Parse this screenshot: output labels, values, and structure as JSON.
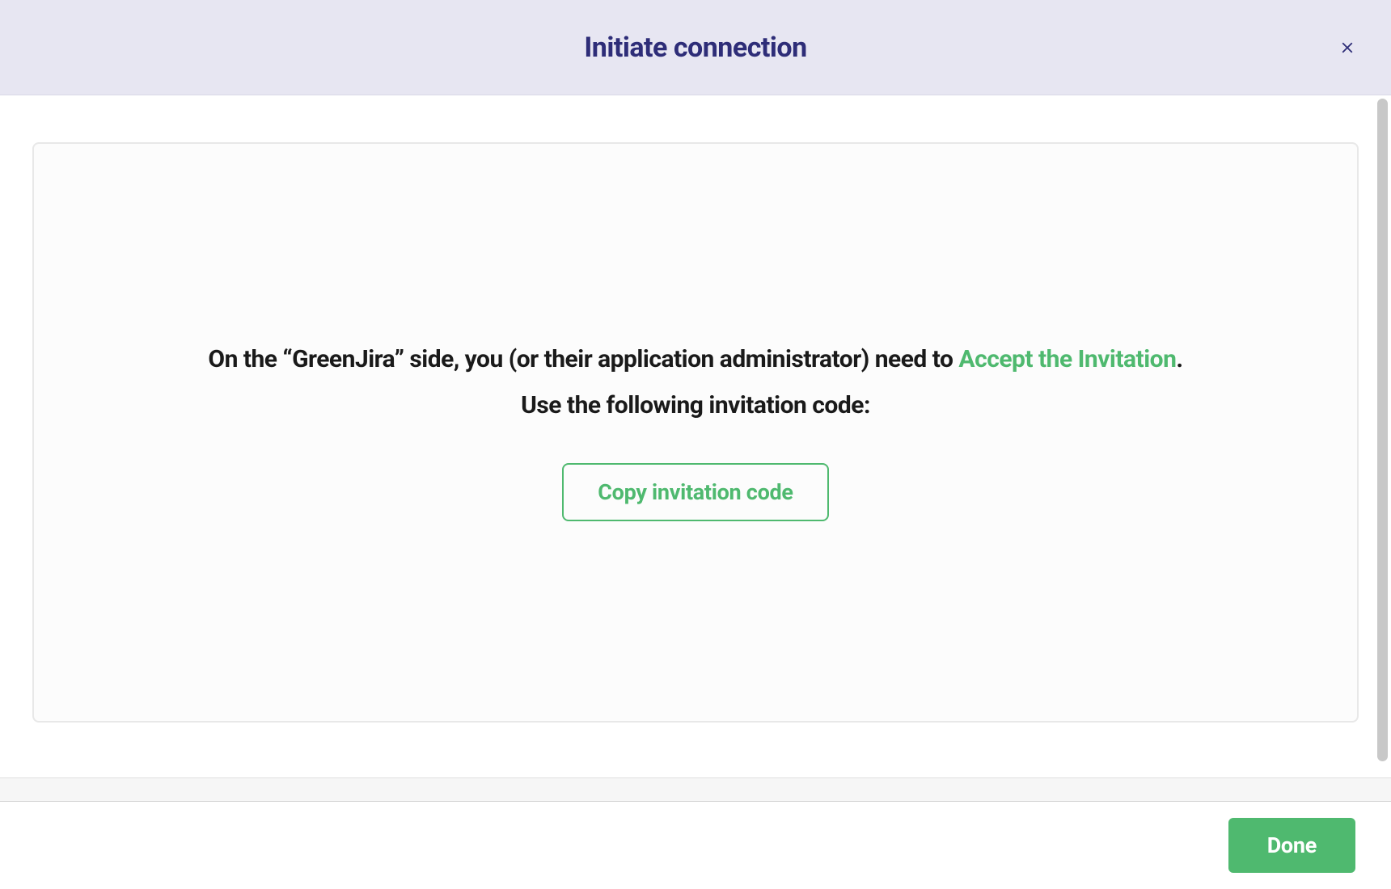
{
  "header": {
    "title": "Initiate connection"
  },
  "content": {
    "instruction_prefix": "On the “",
    "instance_name": "GreenJira",
    "instruction_mid": "” side, you (or their application administrator) need to ",
    "accept_link_text": "Accept the Invitation",
    "instruction_suffix": ".",
    "sub_instruction": "Use the following invitation code:",
    "copy_button_label": "Copy invitation code"
  },
  "footer": {
    "done_button_label": "Done"
  },
  "colors": {
    "header_bg": "#e7e6f2",
    "title_color": "#2e2d78",
    "accent_green": "#4fb96f",
    "text_dark": "#1a1a1a"
  }
}
